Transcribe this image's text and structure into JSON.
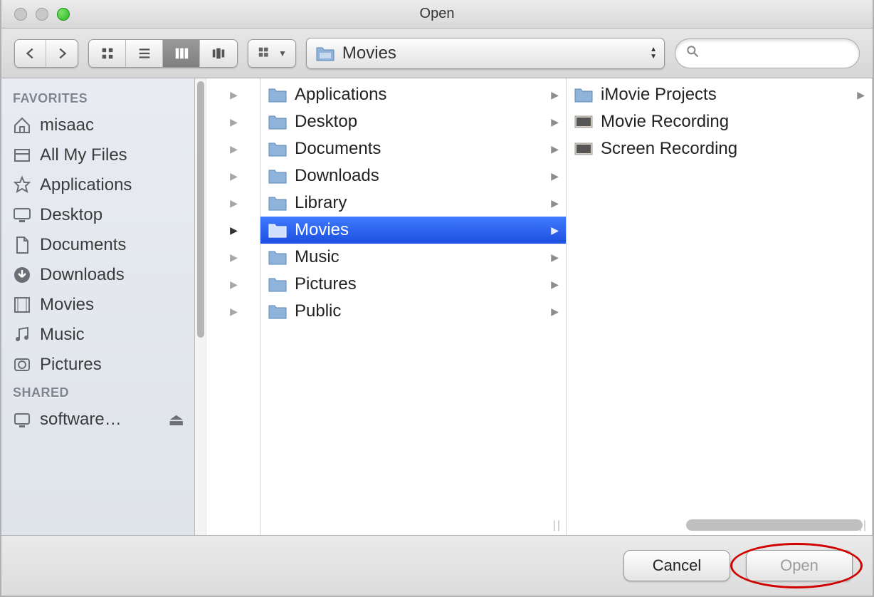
{
  "window": {
    "title": "Open"
  },
  "toolbar": {
    "location_label": "Movies",
    "search_placeholder": ""
  },
  "sidebar": {
    "sections": [
      {
        "header": "FAVORITES",
        "items": [
          {
            "label": "misaac",
            "icon": "home"
          },
          {
            "label": "All My Files",
            "icon": "allfiles"
          },
          {
            "label": "Applications",
            "icon": "apps"
          },
          {
            "label": "Desktop",
            "icon": "desktop"
          },
          {
            "label": "Documents",
            "icon": "docs"
          },
          {
            "label": "Downloads",
            "icon": "downloads"
          },
          {
            "label": "Movies",
            "icon": "movies"
          },
          {
            "label": "Music",
            "icon": "music"
          },
          {
            "label": "Pictures",
            "icon": "pictures"
          }
        ]
      },
      {
        "header": "SHARED",
        "items": [
          {
            "label": "software…",
            "icon": "server",
            "eject": true
          }
        ]
      }
    ]
  },
  "columns": {
    "col1": [
      {
        "label": "Applications",
        "type": "folder",
        "sub": "apps"
      },
      {
        "label": "Desktop",
        "type": "folder",
        "sub": "desktop"
      },
      {
        "label": "Documents",
        "type": "folder",
        "sub": "docs"
      },
      {
        "label": "Downloads",
        "type": "folder",
        "sub": "downloads"
      },
      {
        "label": "Library",
        "type": "folder",
        "sub": "library"
      },
      {
        "label": "Movies",
        "type": "folder",
        "sub": "movies",
        "selected": true
      },
      {
        "label": "Music",
        "type": "folder",
        "sub": "music"
      },
      {
        "label": "Pictures",
        "type": "folder",
        "sub": "pictures"
      },
      {
        "label": "Public",
        "type": "folder",
        "sub": "public"
      }
    ],
    "col2": [
      {
        "label": "iMovie Projects",
        "type": "folder",
        "arrow": true
      },
      {
        "label": "Movie Recording",
        "type": "movfile"
      },
      {
        "label": "Screen Recording",
        "type": "movfile2"
      }
    ]
  },
  "footer": {
    "cancel": "Cancel",
    "open": "Open"
  }
}
